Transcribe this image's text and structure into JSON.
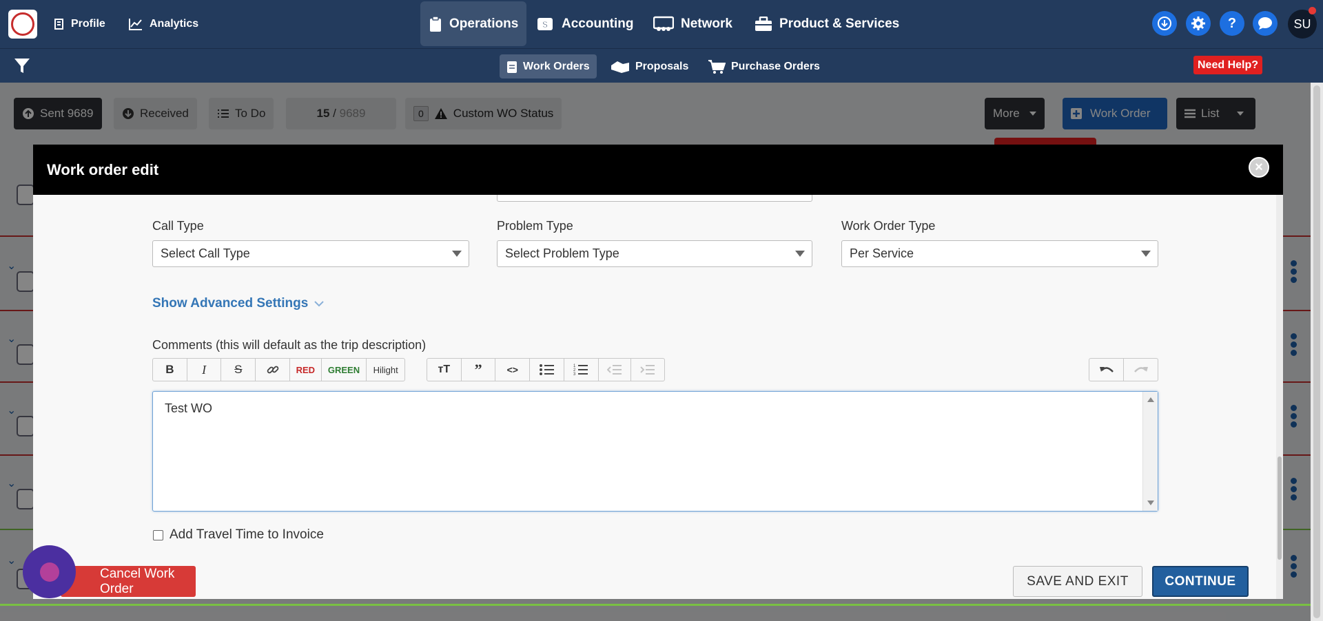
{
  "topnav": {
    "profile": "Profile",
    "analytics": "Analytics",
    "operations": "Operations",
    "accounting": "Accounting",
    "network": "Network",
    "products": "Product & Services",
    "avatar_initials": "SU"
  },
  "subnav": {
    "work_orders": "Work Orders",
    "proposals": "Proposals",
    "purchase_orders": "Purchase Orders",
    "need_help": "Need Help?"
  },
  "toolbar": {
    "sent": "Sent 9689",
    "received": "Received",
    "todo": "To Do",
    "page_current": "15",
    "page_sep": " / ",
    "page_total": "9689",
    "custom_count": "0",
    "custom_status": "Custom WO Status",
    "more": "More",
    "work_order": "Work Order",
    "list": "List"
  },
  "modal": {
    "title": "Work order edit",
    "call_type_label": "Call Type",
    "call_type_value": "Select Call Type",
    "problem_type_label": "Problem Type",
    "problem_type_value": "Select Problem Type",
    "wo_type_label": "Work Order Type",
    "wo_type_value": "Per Service",
    "advanced_settings": "Show Advanced Settings",
    "comments_label": "Comments (this will default as the trip description)",
    "editor_buttons": {
      "red": "RED",
      "green": "GREEN",
      "hilight": "Hilight"
    },
    "comment_text": "Test WO",
    "add_travel_label": "Add Travel Time to Invoice",
    "cancel_button": "Cancel Work Order",
    "save_exit_button": "SAVE AND EXIT",
    "continue_button": "CONTINUE"
  },
  "colors": {
    "nav_bg": "#233b5d",
    "accent_blue": "#225f9e",
    "danger_red": "#d73a37",
    "link_blue": "#3476b6",
    "green_rule": "#79c043"
  }
}
